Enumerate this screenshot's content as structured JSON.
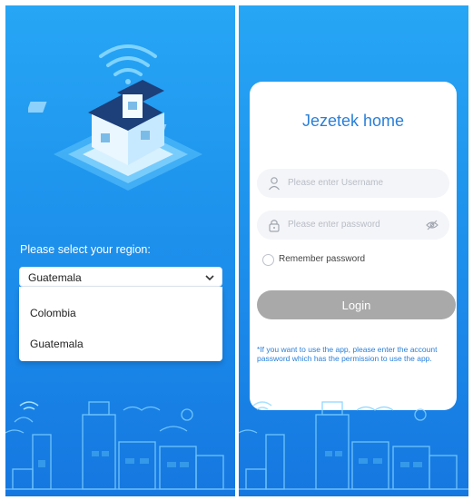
{
  "region": {
    "label": "Please select your region:",
    "selected": "Guatemala",
    "options": [
      "Colombia",
      "Guatemala"
    ]
  },
  "login": {
    "title": "Jezetek home",
    "username_placeholder": "Please enter Username",
    "password_placeholder": "Please enter password",
    "remember_label": "Remember password",
    "remember_checked": false,
    "login_label": "Login",
    "note": "*If you want to use the app, please enter the account password which has the permission to use the app."
  },
  "icons": [
    "wifi-icon",
    "house-illustration",
    "chevron-down-icon",
    "user-icon",
    "lock-icon",
    "eye-hidden-icon"
  ],
  "colors": {
    "background_blue": "#1f96ee",
    "title_blue": "#2a7fd8",
    "login_button_gray": "#a9a9a9",
    "input_bg": "#f4f5f8"
  }
}
